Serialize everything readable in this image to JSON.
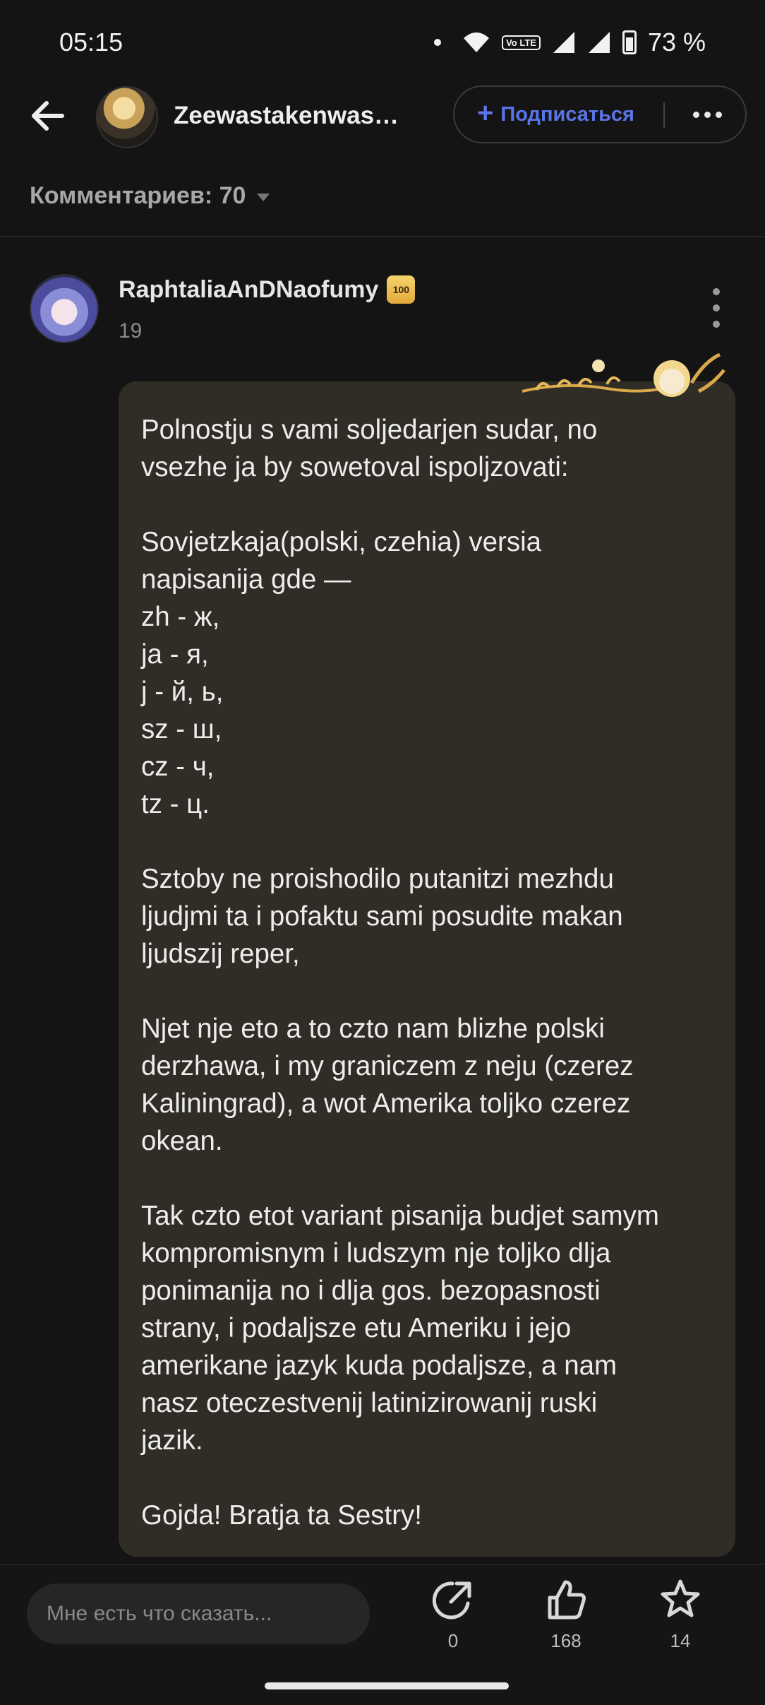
{
  "status_bar": {
    "time": "05:15",
    "volte": "Vo LTE",
    "battery": "73 %"
  },
  "header": {
    "author_name": "Zeewastakenwas…",
    "subscribe_label": "Подписаться"
  },
  "comments": {
    "count_label": "Комментариев: 70"
  },
  "comment": {
    "username": "RaphtaliaAnDNaofumy",
    "badge": "100",
    "count": "19",
    "text": "Polnostju s vami soljedarjen sudar, no\nvsezhe ja by sowetoval ispoljzovati:\n\nSovjetzkaja(polski, czehia) versia\nnapisanija gde —\nzh - ж,\nja - я,\nj - й, ь,\nsz - ш,\ncz - ч,\ntz - ц.\n\nSztoby ne proishodilo putanitzi mezhdu\nljudjmi ta i pofaktu sami posudite makan\nljudszij reper,\n\nNjet nje eto a to czto nam blizhe polski\nderzhawa, i my graniczem z neju (czerez\nKaliningrad), a wot Amerika toljko czerez\nokean.\n\nTak czto etot variant pisanija budjet samym\nkompromisnym i ludszym nje toljko dlja\nponimanija no i dlja gos. bezopasnosti\nstrany, i podaljsze etu Ameriku i jejo\namerikane jazyk kuda podaljsze, a nam\nnasz oteczestvenij latinizirowanij ruski\njazik.\n\nGojda! Bratja ta Sestry!"
  },
  "bottom_bar": {
    "input_placeholder": "Мне есть что сказать...",
    "share_count": "0",
    "like_count": "168",
    "favorite_count": "14"
  },
  "icons": {
    "back": "arrow-left-icon",
    "plus": "plus-icon",
    "more": "more-horizontal-icon",
    "kebab": "more-vertical-icon",
    "share": "share-icon",
    "like": "thumbs-up-icon",
    "favorite": "star-icon"
  },
  "colors": {
    "accent": "#5b74e8",
    "background": "#141414",
    "bubble": "#302c26"
  }
}
